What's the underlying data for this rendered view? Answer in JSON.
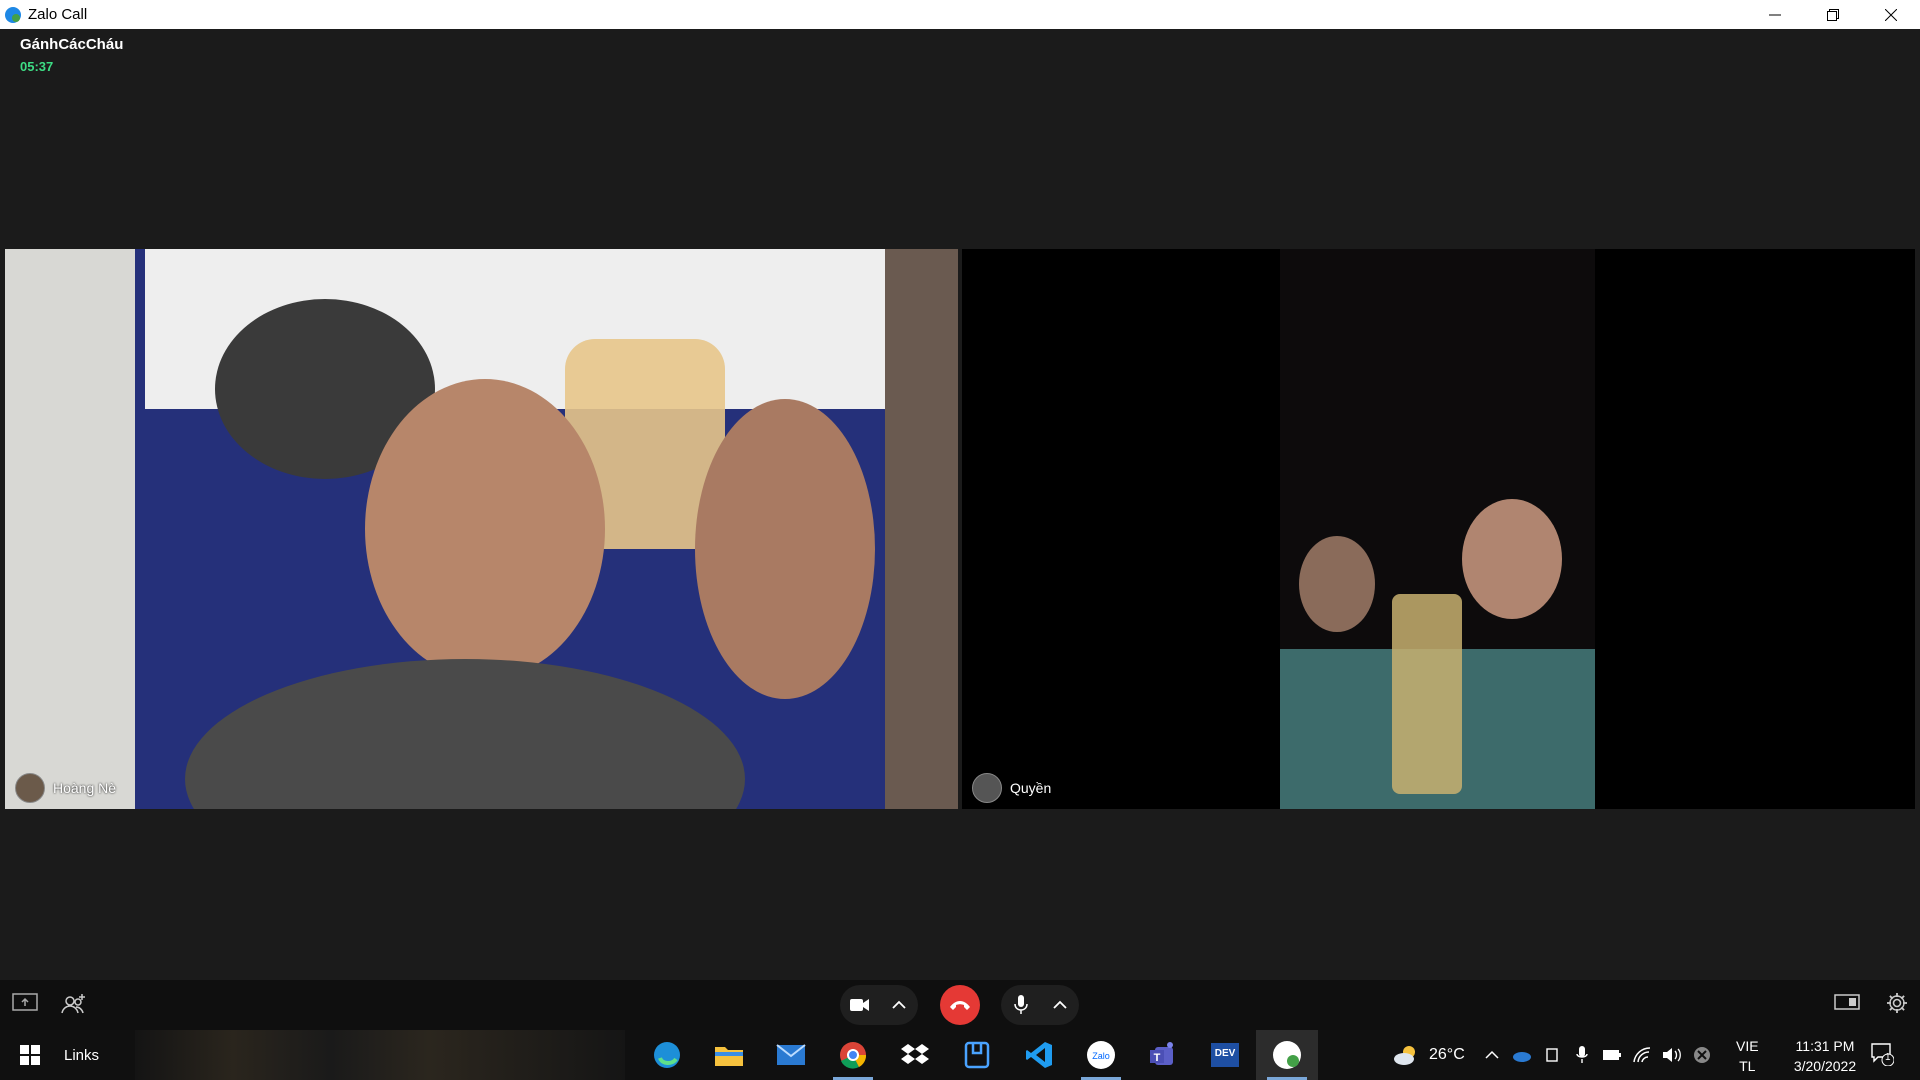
{
  "window": {
    "title": "Zalo Call"
  },
  "call": {
    "title": "GánhCácCháu",
    "timer": "05:37"
  },
  "participants": [
    {
      "name": "Hoàng Nè"
    },
    {
      "name": "Quyền"
    }
  ],
  "taskbar": {
    "links_label": "Links",
    "weather_temp": "26°C",
    "language_top": "VIE",
    "language_bottom": "TL",
    "time": "11:31 PM",
    "date": "3/20/2022",
    "notification_count": "1",
    "apps": [
      "edge-icon",
      "file-explorer-icon",
      "mail-icon",
      "chrome-icon",
      "dropbox-icon",
      "app-icon",
      "vscode-icon",
      "zalo-icon",
      "teams-icon",
      "dev-icon",
      "zalo-call-icon"
    ]
  },
  "colors": {
    "timer": "#3ddc84",
    "end_call": "#e53935"
  }
}
